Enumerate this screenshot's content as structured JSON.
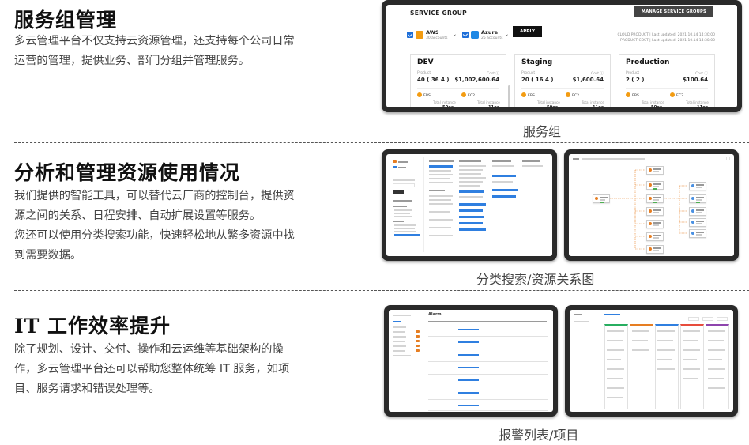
{
  "sections": [
    {
      "title": "服务组管理",
      "body": [
        "多云管理平台不仅支持云资源管理，还支持每个公司日常",
        "运营的管理，提供业务、部门分组并管理服务。"
      ],
      "caption": "服务组"
    },
    {
      "title": "分析和管理资源使用情况",
      "body": [
        "我们提供的智能工具，可以替代云厂商的控制台，提供资",
        "源之间的关系、日程安排、自动扩展设置等服务。",
        "您还可以使用分类搜索功能，快速轻松地从繁多资源中找",
        "到需要数据。"
      ],
      "caption": "分类搜索/资源关系图"
    },
    {
      "title": "IT 工作效率提升",
      "body": [
        "除了规划、设计、交付、操作和云运维等基础架构的操",
        "作，多云管理平台还可以帮助您整体统筹 IT 服务，如项",
        "目、服务请求和错误处理等。"
      ],
      "caption": "报警列表/项目"
    }
  ],
  "service_group": {
    "header": "SERVICE GROUP",
    "manage_button": "MANAGE SERVICE GROUPS",
    "providers": [
      {
        "name": "AWS",
        "sub": "30 accounts",
        "color": "#f39c12"
      },
      {
        "name": "Azure",
        "sub": "25 accounts",
        "color": "#1e88e5"
      }
    ],
    "apply_button": "APPLY",
    "meta_cloud": "CLOUD PRODUCT  |  Last updated: 2021.10.14 14:30:00",
    "meta_product": "PRODUCT COST  |  Last updated: 2021.10.14 14:30:00",
    "cards": [
      {
        "name": "DEV",
        "product_label": "Product",
        "cost_label": "Cost ⓘ",
        "count": "40 ( 36  4 )",
        "cost": "$1,002,600.64",
        "svc1": "EBS",
        "svc2": "EC2",
        "total_label": "Total instance",
        "total1": "50ea",
        "total2": "11ea"
      },
      {
        "name": "Staging",
        "product_label": "Product",
        "cost_label": "Cost ⓘ",
        "count": "20 ( 16  4 )",
        "cost": "$1,600.64",
        "svc1": "EBS",
        "svc2": "EC2",
        "total_label": "Total instance",
        "total1": "50ea",
        "total2": "11ea"
      },
      {
        "name": "Production",
        "product_label": "Product",
        "cost_label": "Cost ⓘ",
        "count": "2 ( 2 )",
        "cost": "$100.64",
        "svc1": "EBS",
        "svc2": "EC2",
        "total_label": "Total instance",
        "total1": "50ea",
        "total2": "11ea"
      }
    ]
  },
  "alarm": {
    "title": "Alarm"
  }
}
